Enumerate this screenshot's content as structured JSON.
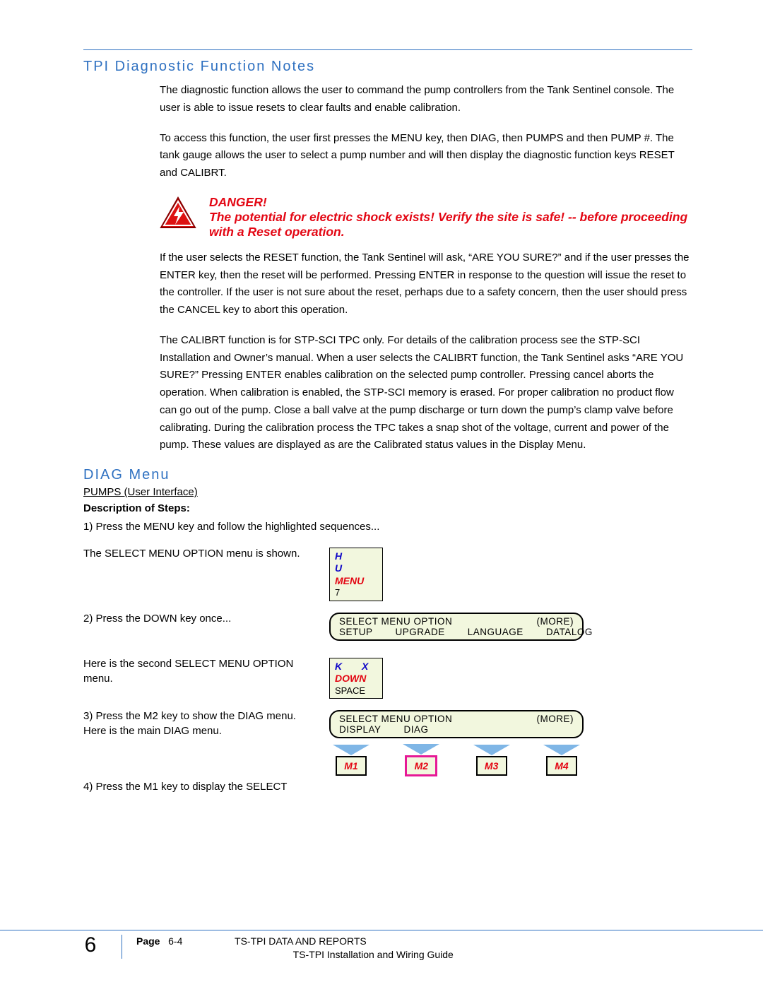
{
  "section_title": "TPI Diagnostic Function Notes",
  "para1": "The diagnostic function allows the user to command the pump controllers from the Tank Sentinel console.  The user is able to issue resets to clear faults and enable calibration.",
  "para2": "To access this function, the user first presses the MENU key, then DIAG, then PUMPS and then PUMP #.  The tank gauge allows the user to select a pump number and will then display the diagnostic function keys RESET and CALIBRT.",
  "danger_title": "DANGER!",
  "danger_body": "The potential for electric shock exists!  Verify the site is safe! -- before proceeding with a Reset operation.",
  "para3": "If the user selects the RESET function, the Tank Sentinel will ask, “ARE YOU SURE?”  and if the user presses the ENTER key, then the reset will be performed.  Pressing ENTER in response to the question will issue the reset to the controller.  If the user is not sure about the reset, perhaps due to a safety concern, then the user should press the CANCEL key to abort this operation.",
  "para4": "The CALIBRT function is for STP-SCI TPC only.  For details of the calibration process see the STP-SCI Installation and Owner’s manual.  When a user selects the CALIBRT function, the Tank Sentinel asks “ARE YOU SURE?”  Pressing ENTER enables calibration on the selected pump controller.  Pressing cancel aborts the operation.  When calibration is enabled, the STP-SCI memory is erased.   For proper calibration no product flow can go out of the pump.  Close a ball valve at the pump discharge or turn down the pump’s clamp valve before calibrating.  During the calibration process the TPC takes a snap shot of the voltage, current and power of the pump.  These values are displayed as are the Calibrated status values in the Display Menu.",
  "diag_title": "DIAG Menu",
  "pumps_ui": "PUMPS (User Interface)",
  "desc_steps": "Description of Steps:",
  "step1": "1) Press the MENU key and follow the highlighted sequences...",
  "step1b": "The SELECT MENU OPTION menu is shown.",
  "step2": "2) Press the DOWN key once...",
  "step2b": "Here is the second SELECT MENU OPTION menu.",
  "step3": "3) Press the M2 key to show the DIAG menu. Here is the main DIAG menu.",
  "step4": "4) Press the M1 key to display the SELECT",
  "key_menu": {
    "letters": "H U",
    "name": "MENU",
    "sub": "7"
  },
  "key_down": {
    "letters": "K X",
    "name": "DOWN",
    "sub": "SPACE"
  },
  "lcd1": {
    "title": "SELECT MENU OPTION",
    "more": "(MORE)",
    "opts": [
      "SETUP",
      "UPGRADE",
      "LANGUAGE",
      "DATALOG"
    ]
  },
  "lcd2": {
    "title": "SELECT MENU OPTION",
    "more": "(MORE)",
    "opts": [
      "DISPLAY",
      "DIAG"
    ]
  },
  "mkeys": [
    "M1",
    "M2",
    "M3",
    "M4"
  ],
  "footer": {
    "chapter": "6",
    "page_label": "Page",
    "page_num": "6-4",
    "line1": "TS-TPI DATA AND REPORTS",
    "line2": "TS-TPI Installation and Wiring Guide"
  }
}
